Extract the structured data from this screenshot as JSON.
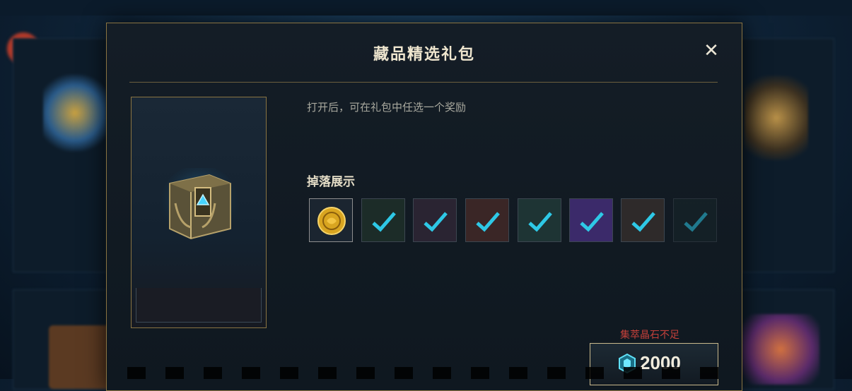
{
  "modal": {
    "title": "藏品精选礼包",
    "close_icon": "close-icon",
    "description": "打开后，可在礼包中任选一个奖励",
    "drops_label": "掉落展示",
    "warning": "集萃晶石不足",
    "price": "2000",
    "currency_icon": "crystal-gem-icon"
  },
  "drop_items": [
    {
      "icon": "coin-emote-icon",
      "owned": false,
      "tint": "#1b2530"
    },
    {
      "icon": "owned-check-icon",
      "owned": true,
      "tint": "#1c2c28"
    },
    {
      "icon": "owned-check-icon",
      "owned": true,
      "tint": "#2a2432"
    },
    {
      "icon": "owned-check-icon",
      "owned": true,
      "tint": "#3a2626"
    },
    {
      "icon": "owned-check-icon",
      "owned": true,
      "tint": "#1e3434"
    },
    {
      "icon": "owned-check-icon",
      "owned": true,
      "tint": "#3b2a6a"
    },
    {
      "icon": "owned-check-icon",
      "owned": true,
      "tint": "#2e2a2a"
    },
    {
      "icon": "owned-check-icon",
      "owned": true,
      "tint": "#18262a"
    }
  ],
  "colors": {
    "accent_gold": "#8a7442",
    "check_cyan": "#2ec8e6",
    "warning_red": "#c4403a"
  }
}
